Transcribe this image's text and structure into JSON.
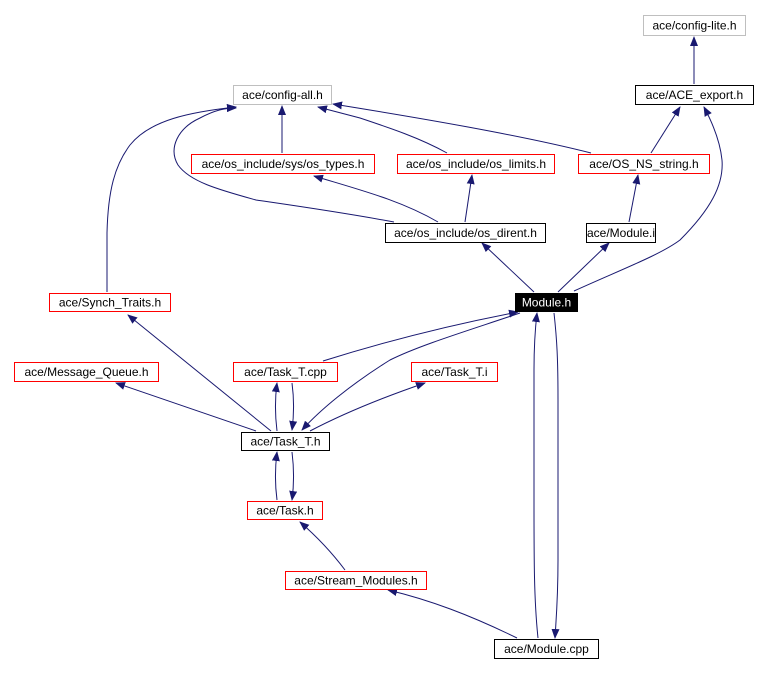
{
  "colors": {
    "edge": "#191970",
    "root_fill": "#000000",
    "linked_border": "#ff0000",
    "documented_border": "#000000",
    "external_border": "#bfbfbf"
  },
  "nodes": [
    {
      "label": "ace/config-lite.h",
      "border": "gray"
    },
    {
      "label": "ace/ACE_export.h",
      "border": "black"
    },
    {
      "label": "ace/config-all.h",
      "border": "gray"
    },
    {
      "label": "ace/os_include/sys/os_types.h",
      "border": "red"
    },
    {
      "label": "ace/os_include/os_limits.h",
      "border": "red"
    },
    {
      "label": "ace/OS_NS_string.h",
      "border": "red"
    },
    {
      "label": "ace/os_include/os_dirent.h",
      "border": "black"
    },
    {
      "label": "ace/Module.i",
      "border": "black"
    },
    {
      "label": "ace/Synch_Traits.h",
      "border": "red"
    },
    {
      "label": "Module.h",
      "border": "root"
    },
    {
      "label": "ace/Message_Queue.h",
      "border": "red"
    },
    {
      "label": "ace/Task_T.cpp",
      "border": "red"
    },
    {
      "label": "ace/Task_T.i",
      "border": "red"
    },
    {
      "label": "ace/Task_T.h",
      "border": "black"
    },
    {
      "label": "ace/Task.h",
      "border": "red"
    },
    {
      "label": "ace/Stream_Modules.h",
      "border": "red"
    },
    {
      "label": "ace/Module.cpp",
      "border": "black"
    }
  ],
  "edges": [
    {
      "from": "ace/ACE_export.h",
      "to": "ace/config-lite.h"
    },
    {
      "from": "ace/OS_NS_string.h",
      "to": "ace/ACE_export.h"
    },
    {
      "from": "Module.h",
      "to": "ace/ACE_export.h"
    },
    {
      "from": "ace/os_include/sys/os_types.h",
      "to": "ace/config-all.h"
    },
    {
      "from": "ace/os_include/os_limits.h",
      "to": "ace/config-all.h"
    },
    {
      "from": "ace/OS_NS_string.h",
      "to": "ace/config-all.h"
    },
    {
      "from": "ace/Synch_Traits.h",
      "to": "ace/config-all.h"
    },
    {
      "from": "ace/os_include/os_dirent.h",
      "to": "ace/config-all.h"
    },
    {
      "from": "ace/os_include/os_dirent.h",
      "to": "ace/os_include/sys/os_types.h"
    },
    {
      "from": "ace/os_include/os_dirent.h",
      "to": "ace/os_include/os_limits.h"
    },
    {
      "from": "ace/Module.i",
      "to": "ace/OS_NS_string.h"
    },
    {
      "from": "Module.h",
      "to": "ace/os_include/os_dirent.h"
    },
    {
      "from": "Module.h",
      "to": "ace/Module.i"
    },
    {
      "from": "ace/Task_T.h",
      "to": "ace/Synch_Traits.h"
    },
    {
      "from": "ace/Task_T.h",
      "to": "ace/Message_Queue.h"
    },
    {
      "from": "ace/Task_T.h",
      "to": "ace/Task_T.cpp"
    },
    {
      "from": "ace/Task_T.cpp",
      "to": "ace/Task_T.h"
    },
    {
      "from": "ace/Task_T.cpp",
      "to": "Module.h"
    },
    {
      "from": "Module.h",
      "to": "ace/Task_T.h"
    },
    {
      "from": "ace/Task_T.h",
      "to": "ace/Task_T.i"
    },
    {
      "from": "ace/Task.h",
      "to": "ace/Task_T.h"
    },
    {
      "from": "ace/Task_T.h",
      "to": "ace/Task.h"
    },
    {
      "from": "ace/Stream_Modules.h",
      "to": "ace/Task.h"
    },
    {
      "from": "ace/Module.cpp",
      "to": "ace/Stream_Modules.h"
    },
    {
      "from": "ace/Module.cpp",
      "to": "Module.h"
    },
    {
      "from": "Module.h",
      "to": "ace/Module.cpp"
    }
  ]
}
